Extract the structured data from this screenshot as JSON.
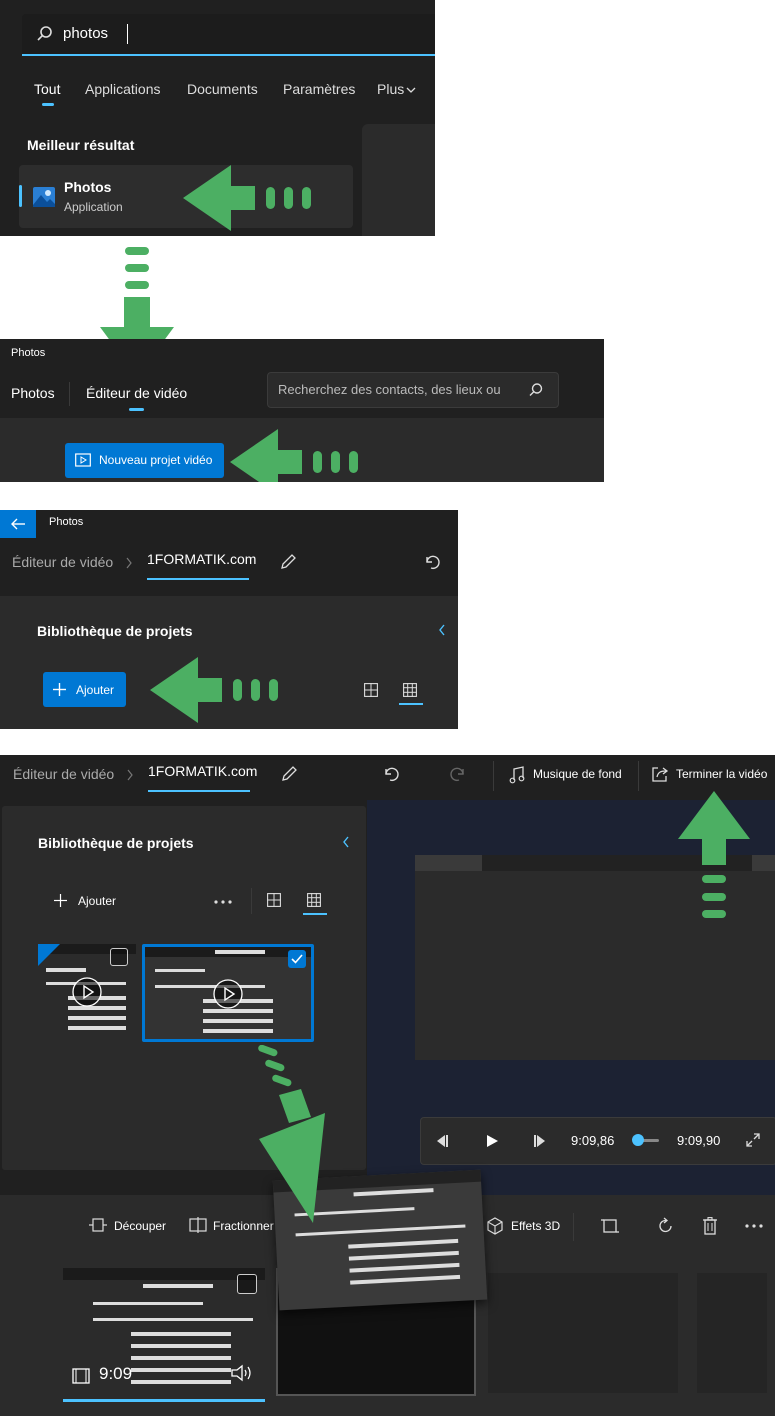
{
  "panel1": {
    "search_value": "photos",
    "tabs": [
      "Tout",
      "Applications",
      "Documents",
      "Paramètres",
      "Plus"
    ],
    "best_result_heading": "Meilleur résultat",
    "result_title": "Photos",
    "result_subtitle": "Application"
  },
  "panel2": {
    "window_title": "Photos",
    "nav_tabs": [
      "Photos",
      "Éditeur de vidéo"
    ],
    "search_placeholder": "Recherchez des contacts, des lieux ou",
    "new_project_button": "Nouveau projet vidéo"
  },
  "panel3": {
    "window_title": "Photos",
    "breadcrumb_parent": "Éditeur de vidéo",
    "project_name": "1FORMATIK.com",
    "library_heading": "Bibliothèque de projets",
    "add_button": "Ajouter"
  },
  "panel4": {
    "breadcrumb_parent": "Éditeur de vidéo",
    "project_name": "1FORMATIK.com",
    "music_button": "Musique de fond",
    "finish_button": "Terminer la vidéo",
    "library_heading": "Bibliothèque de projets",
    "add_button": "Ajouter",
    "time_current": "9:09,86",
    "time_total": "9:09,90",
    "toolbar": {
      "trim": "Découper",
      "split": "Fractionner",
      "effects3d": "Effets 3D"
    },
    "storyboard_duration": "9:09"
  },
  "colors": {
    "arrow": "#4caf63",
    "accent": "#0078d4",
    "panel_dark": "#202020"
  }
}
